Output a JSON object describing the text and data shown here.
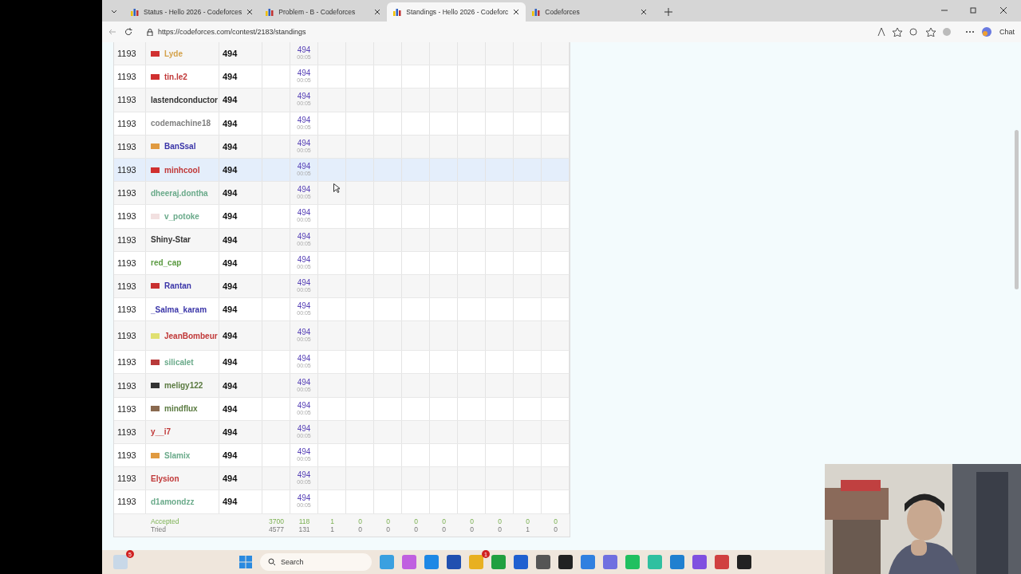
{
  "tabs": [
    {
      "title": "Status - Hello 2026 - Codeforces",
      "selected": false
    },
    {
      "title": "Problem - B - Codeforces",
      "selected": false
    },
    {
      "title": "Standings - Hello 2026 - Codeforc",
      "selected": true
    },
    {
      "title": "Codeforces",
      "selected": false
    }
  ],
  "address": "https://codeforces.com/contest/2183/standings",
  "chat_label": "Chat",
  "rows": [
    {
      "rank": "1193",
      "name": "Lyde",
      "color": "#d4a24a",
      "flag": {
        "color": "#d03030"
      },
      "score": "494",
      "cell": "494",
      "time": "00:05",
      "selected": false
    },
    {
      "rank": "1193",
      "name": "tin.le2",
      "color": "#c03838",
      "flag": {
        "color": "#d03030"
      },
      "score": "494",
      "cell": "494",
      "time": "00:05",
      "selected": false
    },
    {
      "rank": "1193",
      "name": "lastendconductor",
      "color": "#333333",
      "score": "494",
      "cell": "494",
      "time": "00:05",
      "selected": false
    },
    {
      "rank": "1193",
      "name": "codemachine18",
      "color": "#808080",
      "score": "494",
      "cell": "494",
      "time": "00:05",
      "selected": false
    },
    {
      "rank": "1193",
      "name": "BanSsal",
      "color": "#3a35a8",
      "flag": {
        "color": "#e09a40"
      },
      "score": "494",
      "cell": "494",
      "time": "00:05",
      "selected": false
    },
    {
      "rank": "1193",
      "name": "minhcool",
      "color": "#c03838",
      "flag": {
        "color": "#d03030"
      },
      "score": "494",
      "cell": "494",
      "time": "00:05",
      "selected": true
    },
    {
      "rank": "1193",
      "name": "dheeraj.dontha",
      "color": "#6aaa8a",
      "score": "494",
      "cell": "494",
      "time": "00:05",
      "selected": false
    },
    {
      "rank": "1193",
      "name": "v_potoke",
      "color": "#6aaa8a",
      "flag": {
        "color": "#f2e0e0"
      },
      "score": "494",
      "cell": "494",
      "time": "00:05",
      "selected": false
    },
    {
      "rank": "1193",
      "name": "Shiny-Star",
      "color": "#333333",
      "score": "494",
      "cell": "494",
      "time": "00:05",
      "selected": false
    },
    {
      "rank": "1193",
      "name": "red_cap",
      "color": "#5a9a40",
      "score": "494",
      "cell": "494",
      "time": "00:05",
      "selected": false
    },
    {
      "rank": "1193",
      "name": "Rantan",
      "color": "#3a35a8",
      "flag": {
        "color": "#c83030"
      },
      "score": "494",
      "cell": "494",
      "time": "00:05",
      "selected": false
    },
    {
      "rank": "1193",
      "name": "_Salma_karam",
      "color": "#3a35a8",
      "score": "494",
      "cell": "494",
      "time": "00:05",
      "selected": false
    },
    {
      "rank": "1193",
      "name": "JeanBombeur",
      "color": "#c03838",
      "flag": {
        "color": "#e0e070"
      },
      "score": "494",
      "cell": "494",
      "time": "00:05",
      "selected": false
    },
    {
      "rank": "1193",
      "name": "silicalet",
      "color": "#6aaa8a",
      "flag": {
        "color": "#b83a3a"
      },
      "score": "494",
      "cell": "494",
      "time": "00:05",
      "selected": false
    },
    {
      "rank": "1193",
      "name": "meligy122",
      "color": "#5a7a40",
      "flag": {
        "color": "#333333"
      },
      "score": "494",
      "cell": "494",
      "time": "00:05",
      "selected": false
    },
    {
      "rank": "1193",
      "name": "mindflux",
      "color": "#5a7a40",
      "flag": {
        "color": "#8a6a50"
      },
      "score": "494",
      "cell": "494",
      "time": "00:05",
      "selected": false
    },
    {
      "rank": "1193",
      "name": "y__i7",
      "color": "#c03838",
      "score": "494",
      "cell": "494",
      "time": "00:05",
      "selected": false
    },
    {
      "rank": "1193",
      "name": "Slamix",
      "color": "#6aaa8a",
      "flag": {
        "color": "#e09a40"
      },
      "score": "494",
      "cell": "494",
      "time": "00:05",
      "selected": false
    },
    {
      "rank": "1193",
      "name": "Elysion",
      "color": "#c03838",
      "score": "494",
      "cell": "494",
      "time": "00:05",
      "selected": false
    },
    {
      "rank": "1193",
      "name": "d1amondzz",
      "color": "#6aaa8a",
      "score": "494",
      "cell": "494",
      "time": "00:05",
      "selected": false
    }
  ],
  "footer": {
    "accepted_label": "Accepted",
    "tried_label": "Tried",
    "accepted": [
      "3700",
      "118",
      "1",
      "0",
      "0",
      "0",
      "0",
      "0",
      "0",
      "0",
      "0"
    ],
    "tried": [
      "4577",
      "131",
      "1",
      "0",
      "0",
      "0",
      "0",
      "0",
      "0",
      "1",
      "0"
    ]
  },
  "taskbar": {
    "mail_badge": "5",
    "search_placeholder": "Search",
    "store_badge": "1"
  }
}
